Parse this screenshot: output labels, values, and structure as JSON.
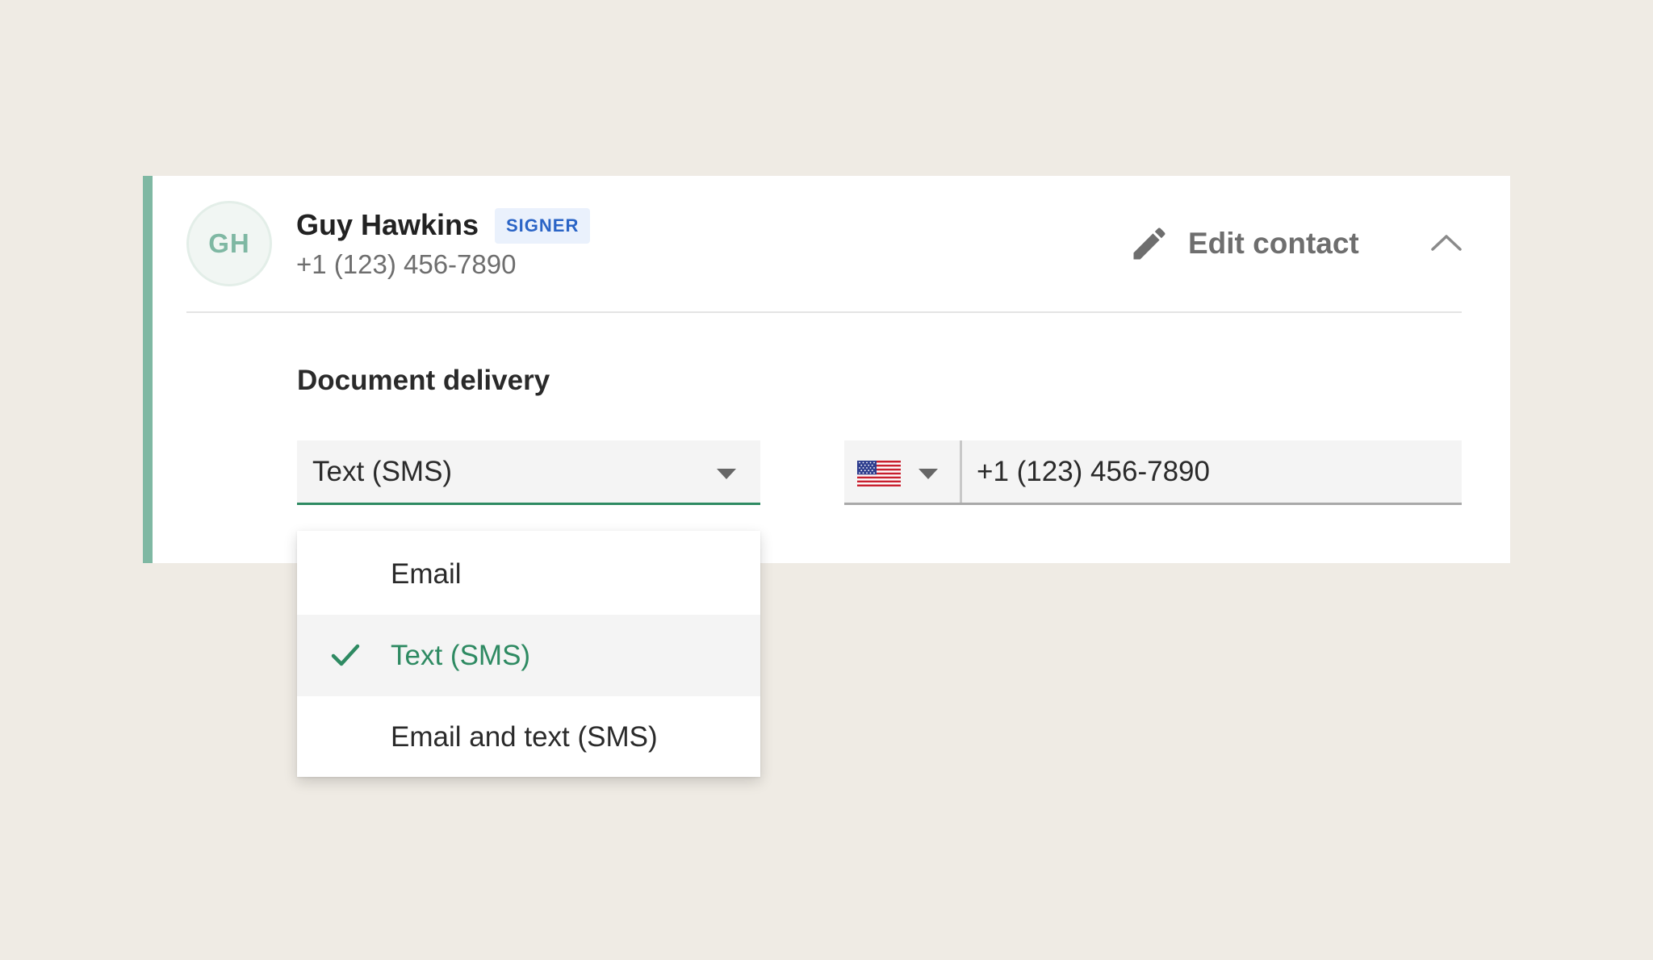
{
  "contact": {
    "initials": "GH",
    "name": "Guy Hawkins",
    "role_badge": "SIGNER",
    "phone": "+1 (123) 456-7890"
  },
  "header": {
    "edit_label": "Edit contact",
    "edit_icon": "pencil-icon",
    "collapse_icon": "chevron-up-icon"
  },
  "delivery": {
    "title": "Document delivery",
    "selected_value": "Text (SMS)",
    "options": [
      {
        "label": "Email",
        "selected": false
      },
      {
        "label": "Text (SMS)",
        "selected": true
      },
      {
        "label": "Email and text (SMS)",
        "selected": false
      }
    ]
  },
  "phone_field": {
    "country_flag": "us-flag-icon",
    "value": "+1 (123) 456-7890"
  },
  "colors": {
    "background": "#efebe4",
    "accent": "#7fb8a3",
    "brand_green": "#2e8a62",
    "badge_text": "#2a64c6",
    "badge_bg": "#eaf1fc"
  }
}
